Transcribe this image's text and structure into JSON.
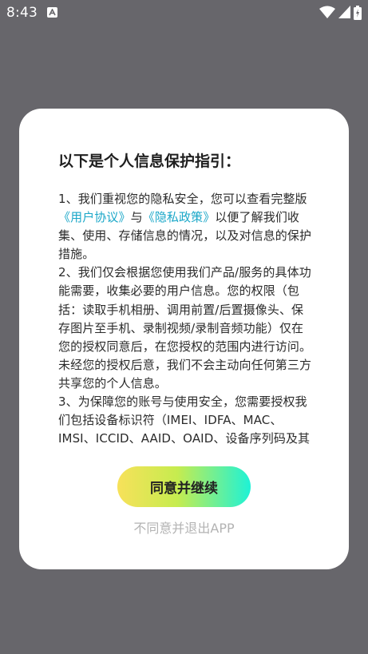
{
  "status_bar": {
    "time": "8:43",
    "icons": [
      "app-a-icon",
      "wifi-icon",
      "signal-icon",
      "battery-icon"
    ]
  },
  "dialog": {
    "title": "以下是个人信息保护指引：",
    "paragraph1": {
      "prefix": "1、我们重视您的隐私安全，您可以查看完整版",
      "link_user_agreement": "《用户协议》",
      "conjunction": "与",
      "link_privacy_policy": "《隐私政策》",
      "suffix": "以便了解我们收集、使用、存储信息的情况，以及对信息的保护措施。"
    },
    "paragraph2": "2、我们仅会根据您使用我们产品/服务的具体功能需要，收集必要的用户信息。您的权限（包括：读取手机相册、调用前置/后置摄像头、保存图片至手机、录制视频/录制音频功能）仅在您的授权同意后，在您授权的范围内进行访问。未经您的授权后意，我们不会主动向任何第三方共享您的个人信息。",
    "paragraph3": "3、为保障您的账号与使用安全，您需要授权我们包括设备标识符（IMEI、IDFA、MAC、IMSI、ICCID、AAID、OAID、设备序列码及其",
    "agree_button": "同意并继续",
    "disagree_link": "不同意并退出APP"
  },
  "colors": {
    "overlay": "#67666b",
    "link": "#1aa7c8",
    "button_gradient_start": "#f7e15a",
    "button_gradient_end": "#1ef2d6",
    "disagree_text": "#b3b3b3"
  }
}
